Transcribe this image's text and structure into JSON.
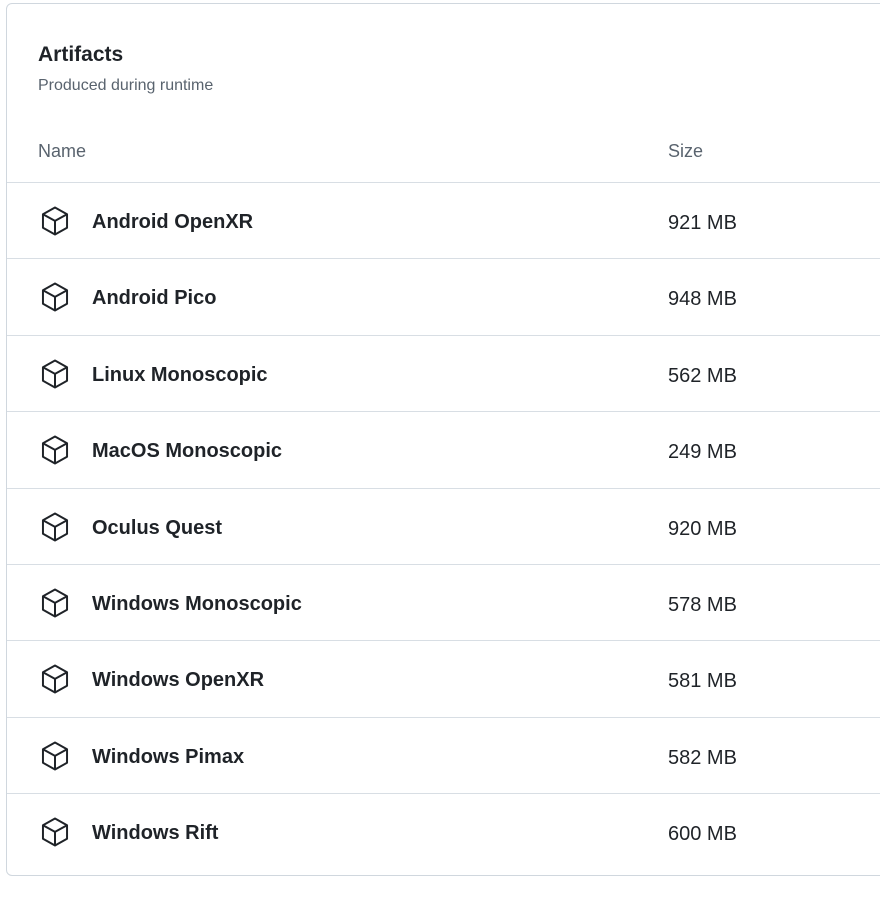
{
  "card": {
    "title": "Artifacts",
    "subtitle": "Produced during runtime"
  },
  "table": {
    "columns": [
      "Name",
      "Size"
    ],
    "rows": [
      {
        "name": "Android OpenXR",
        "size": "921 MB",
        "icon": "package-icon"
      },
      {
        "name": "Android Pico",
        "size": "948 MB",
        "icon": "package-icon"
      },
      {
        "name": "Linux Monoscopic",
        "size": "562 MB",
        "icon": "package-icon"
      },
      {
        "name": "MacOS Monoscopic",
        "size": "249 MB",
        "icon": "package-icon"
      },
      {
        "name": "Oculus Quest",
        "size": "920 MB",
        "icon": "package-icon"
      },
      {
        "name": "Windows Monoscopic",
        "size": "578 MB",
        "icon": "package-icon"
      },
      {
        "name": "Windows OpenXR",
        "size": "581 MB",
        "icon": "package-icon"
      },
      {
        "name": "Windows Pimax",
        "size": "582 MB",
        "icon": "package-icon"
      },
      {
        "name": "Windows Rift",
        "size": "600 MB",
        "icon": "package-icon"
      }
    ]
  }
}
